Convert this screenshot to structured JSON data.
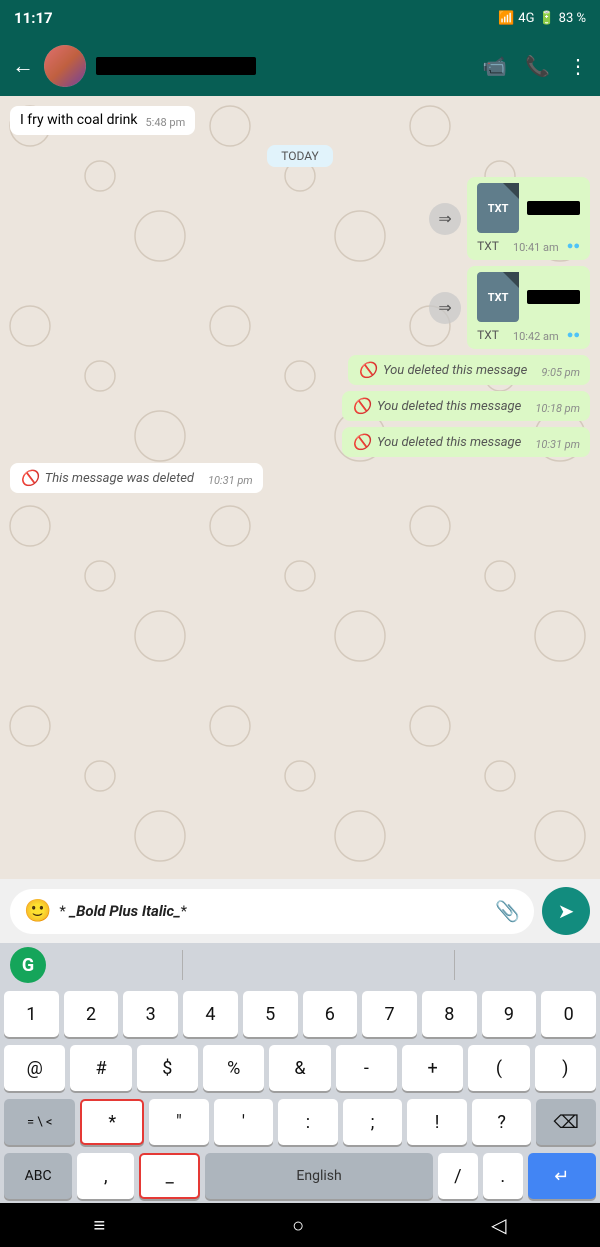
{
  "statusBar": {
    "time": "11:17",
    "signal": "4G",
    "battery": "83 %"
  },
  "header": {
    "contactNameRedacted": true,
    "icons": {
      "video": "📹",
      "call": "📞",
      "more": "⋮"
    }
  },
  "chat": {
    "oldMessage": {
      "text": "I fry with coal drink",
      "time": "5:48 pm"
    },
    "dateDivider": "TODAY",
    "messages": [
      {
        "id": "msg1",
        "type": "file",
        "fileType": "TXT",
        "time": "10:41 am",
        "direction": "sent",
        "ticks": "✔✔"
      },
      {
        "id": "msg2",
        "type": "file",
        "fileType": "TXT",
        "time": "10:42 am",
        "direction": "sent",
        "ticks": "✔✔"
      },
      {
        "id": "msg3",
        "type": "deleted",
        "text": "You deleted this message",
        "time": "9:05 pm",
        "direction": "sent"
      },
      {
        "id": "msg4",
        "type": "deleted",
        "text": "You deleted this message",
        "time": "10:18 pm",
        "direction": "sent"
      },
      {
        "id": "msg5",
        "type": "deleted",
        "text": "You deleted this message",
        "time": "10:31 pm",
        "direction": "sent"
      },
      {
        "id": "msg6",
        "type": "deleted",
        "text": "This message was deleted",
        "time": "10:31 pm",
        "direction": "received"
      }
    ]
  },
  "inputBar": {
    "emojiIcon": "🙂",
    "inputText": "* _Bold Plus Italic_*",
    "inputDisplay": {
      "prefix": "* ",
      "bold": "Bold Plus Italic",
      "suffix": "_*"
    },
    "attachIcon": "📎",
    "sendIcon": "➤"
  },
  "keyboard": {
    "grammarlyLabel": "G",
    "row1": [
      "1",
      "2",
      "3",
      "4",
      "5",
      "6",
      "7",
      "8",
      "9",
      "0"
    ],
    "row2": [
      "@",
      "#",
      "$",
      "%",
      "&",
      "-",
      "+",
      "(",
      ")"
    ],
    "row3Left": "=\\<",
    "row3Keys": [
      "*",
      "\"",
      "'",
      ":",
      ";",
      "!",
      "?"
    ],
    "row4": {
      "abc": "ABC",
      "comma": ",",
      "underscore": "_",
      "space": "English",
      "slash": "/",
      "dot": ".",
      "enter": "↵"
    }
  },
  "navBar": {
    "home": "≡",
    "circle": "○",
    "back": "◁"
  }
}
